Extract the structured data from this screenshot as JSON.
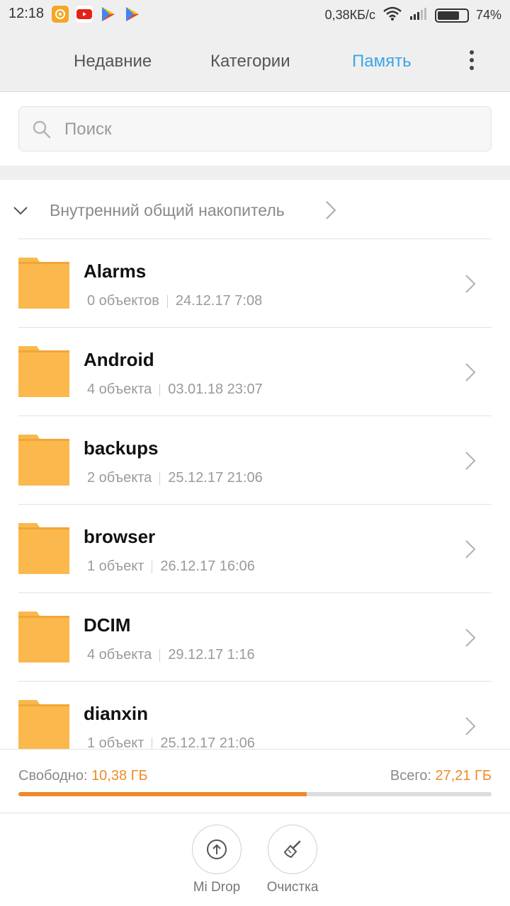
{
  "status_bar": {
    "time": "12:18",
    "network_speed": "0,38КБ/с",
    "battery_percent": "74%",
    "battery_level": 0.74,
    "app_icons": [
      "chat-app-icon",
      "youtube-icon",
      "play-store-icon",
      "play-store-icon"
    ]
  },
  "tabs": [
    {
      "label": "Недавние",
      "active": false
    },
    {
      "label": "Категории",
      "active": false
    },
    {
      "label": "Память",
      "active": true
    }
  ],
  "search": {
    "placeholder": "Поиск"
  },
  "storage": {
    "title": "Внутренний общий накопитель"
  },
  "files": [
    {
      "name": "Alarms",
      "count": "0 объектов",
      "date": "24.12.17 7:08"
    },
    {
      "name": "Android",
      "count": "4 объекта",
      "date": "03.01.18 23:07"
    },
    {
      "name": "backups",
      "count": "2 объекта",
      "date": "25.12.17 21:06"
    },
    {
      "name": "browser",
      "count": "1 объект",
      "date": "26.12.17 16:06"
    },
    {
      "name": "DCIM",
      "count": "4 объекта",
      "date": "29.12.17 1:16"
    },
    {
      "name": "dianxin",
      "count": "1 объект",
      "date": "25.12.17 21:06"
    }
  ],
  "footer": {
    "free_label": "Свободно:",
    "free_value": "10,38 ГБ",
    "total_label": "Всего:",
    "total_value": "27,21 ГБ",
    "used_fraction": 0.61
  },
  "actions": {
    "mi_drop": "Mi Drop",
    "cleanup": "Очистка"
  },
  "colors": {
    "accent_blue": "#3ba5e8",
    "accent_orange": "#ef8a2a",
    "folder": "#fbb84c"
  }
}
